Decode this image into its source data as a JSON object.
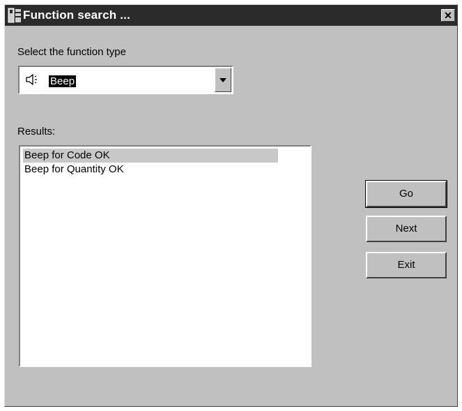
{
  "window": {
    "title": "Function search ...",
    "close_label": "✕"
  },
  "function_type": {
    "label": "Select the function type",
    "selected_value": "Beep",
    "icon": "speaker-icon"
  },
  "results": {
    "label": "Results:",
    "items": [
      {
        "label": "Beep for Code OK",
        "selected": true
      },
      {
        "label": "Beep for Quantity OK",
        "selected": false
      }
    ]
  },
  "buttons": {
    "go": "Go",
    "next": "Next",
    "exit": "Exit"
  },
  "colors": {
    "titlebar": "#2b2b2b",
    "dialog_face": "#c0c0c0",
    "selection": "#c8c8c8"
  }
}
